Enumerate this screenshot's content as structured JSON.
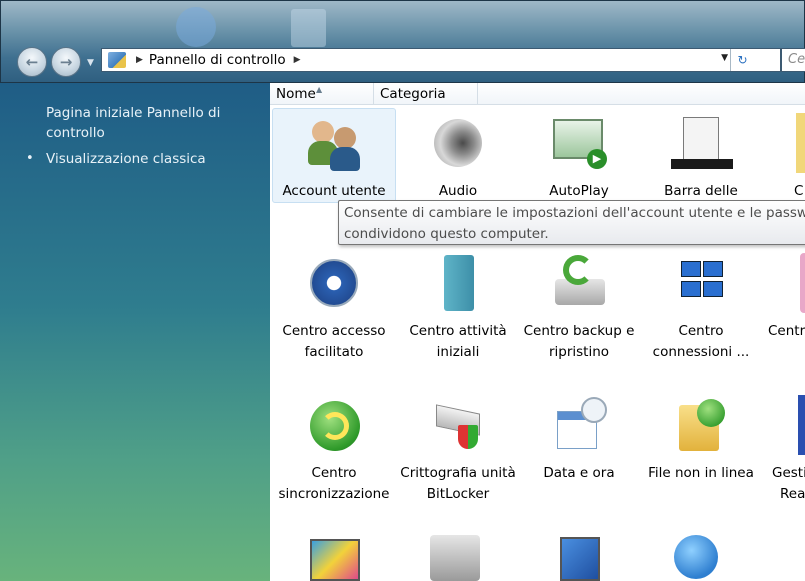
{
  "address": {
    "location": "Pannello di controllo",
    "search_placeholder": "Ce"
  },
  "sidebar": {
    "home_link": "Pagina iniziale Pannello di controllo",
    "classic_view": "Visualizzazione classica"
  },
  "columns": {
    "name": "Nome",
    "category": "Categoria"
  },
  "tooltip": {
    "text_line1": "Consente di cambiare le impostazioni dell'account utente e le passw",
    "text_line2": "condividono questo computer."
  },
  "items": {
    "account_utente": "Account utente",
    "audio": "Audio",
    "autoplay": "AutoPlay",
    "barra_delle": "Barra delle",
    "partial_c": "C",
    "centro_accesso_1": "Centro accesso",
    "centro_accesso_2": "facilitato",
    "centro_attivita_1": "Centro attività",
    "centro_attivita_2": "iniziali",
    "centro_backup_1": "Centro backup e",
    "centro_backup_2": "ripristino",
    "centro_connessioni_1": "Centro",
    "centro_connessioni_2": "connessioni ...",
    "partial_centr": "Centr",
    "centro_sync_1": "Centro",
    "centro_sync_2": "sincronizzazione",
    "crittografia_1": "Crittografia unità",
    "crittografia_2": "BitLocker",
    "data_ora": "Data e ora",
    "file_offline": "File non in linea",
    "partial_gesti_1": "Gesti",
    "partial_gesti_2": "Rea"
  }
}
